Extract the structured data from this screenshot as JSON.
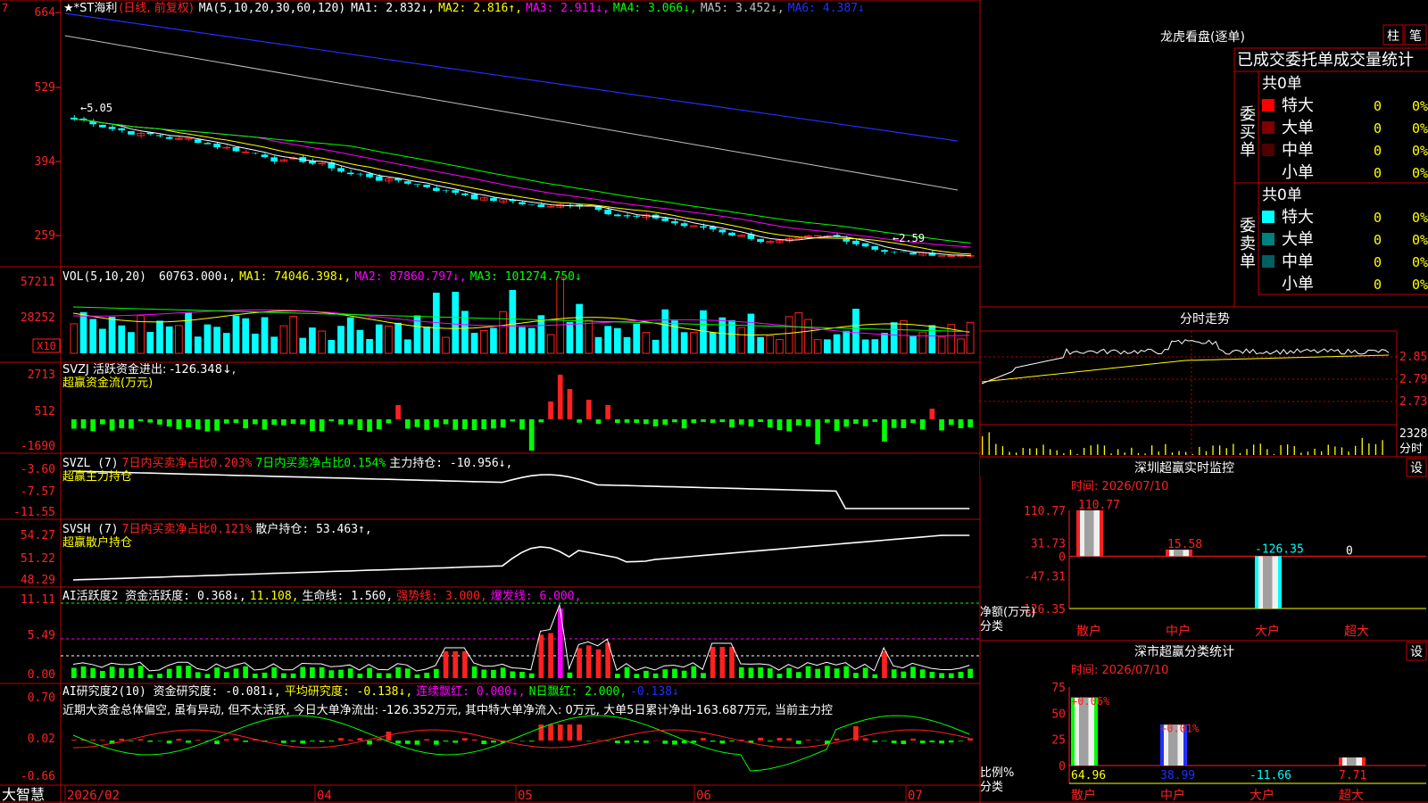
{
  "colors": {
    "up": "#ff2020",
    "down": "#00ffff",
    "frame": "#c00000",
    "yellow": "#ffff00",
    "magenta": "#ff00ff",
    "green": "#00ff00",
    "blue": "#2030ff",
    "gray": "#c0c0c0",
    "white": "#ffffff"
  },
  "header": {
    "stock": "★*ST海利",
    "period": "(日线, 前复权)",
    "ma_label": "MA(5,10,20,30,60,120)",
    "ma": [
      {
        "text": "MA1: 2.832↓,",
        "color": "#ffffff"
      },
      {
        "text": "MA2: 2.816↑,",
        "color": "#ffff00"
      },
      {
        "text": "MA3: 2.911↓,",
        "color": "#ff00ff"
      },
      {
        "text": "MA4: 3.066↓,",
        "color": "#00ff00"
      },
      {
        "text": "MA5: 3.452↓,",
        "color": "#c0c0c0"
      },
      {
        "text": "MA6: 4.387↓",
        "color": "#2030ff"
      }
    ]
  },
  "price_axis": [
    "664",
    "529",
    "394",
    "259"
  ],
  "price_labels": {
    "high": "5.05",
    "low": "2.59"
  },
  "vol_panel": {
    "label": "VOL(5,10,20)",
    "items": [
      {
        "text": "60763.000↓,",
        "color": "#ffffff"
      },
      {
        "text": "MA1: 74046.398↓,",
        "color": "#ffff00"
      },
      {
        "text": "MA2: 87860.797↓,",
        "color": "#ff00ff"
      },
      {
        "text": "MA3: 101274.750↓",
        "color": "#00ff00"
      }
    ],
    "axis": [
      "57211",
      "28252"
    ],
    "unit": "X10"
  },
  "svzj_panel": {
    "line1": "SVZJ  活跃资金进出: -126.348↓,",
    "line2": "超赢资金流(万元)",
    "axis": [
      "2713",
      "512",
      "-1690"
    ]
  },
  "svzl_panel": {
    "items": [
      {
        "text": "SVZL (7)",
        "color": "#ffffff"
      },
      {
        "text": "7日内买卖净占比0.203%",
        "color": "#ff2020"
      },
      {
        "text": "7日内买卖净占比0.154%",
        "color": "#00ff00"
      },
      {
        "text": "主力持仓: -10.956↓,",
        "color": "#ffffff"
      }
    ],
    "line2": "超赢主力持仓",
    "axis": [
      "-3.60",
      "-7.57",
      "-11.55"
    ]
  },
  "svsh_panel": {
    "items": [
      {
        "text": "SVSH (7)",
        "color": "#ffffff"
      },
      {
        "text": "7日内买卖净占比0.121%",
        "color": "#ff2020"
      },
      {
        "text": "散户持仓: 53.463↑,",
        "color": "#ffffff"
      }
    ],
    "line2": "超赢散户持仓",
    "axis": [
      "54.27",
      "51.22",
      "48.29"
    ]
  },
  "ai_active_panel": {
    "items": [
      {
        "text": "AI活跃度2 资金活跃度: 0.368↓,",
        "color": "#ffffff"
      },
      {
        "text": "11.108,",
        "color": "#ffff00"
      },
      {
        "text": "生命线: 1.560,",
        "color": "#ffffff"
      },
      {
        "text": "强势线: 3.000,",
        "color": "#ff2020"
      },
      {
        "text": "爆发线: 6.000,",
        "color": "#ff00ff"
      }
    ],
    "axis": [
      "11.11",
      "5.49",
      "0.00"
    ]
  },
  "ai_research_panel": {
    "items": [
      {
        "text": "AI研究度2(10) 资金研究度: -0.081↓,",
        "color": "#ffffff"
      },
      {
        "text": "平均研究度: -0.138↓,",
        "color": "#ffff00"
      },
      {
        "text": "连续飘红: 0.000↓,",
        "color": "#ff00ff"
      },
      {
        "text": "N日飘红: 2.000,",
        "color": "#00ff00"
      },
      {
        "text": "-0.138↓",
        "color": "#2030ff"
      }
    ],
    "comment": "近期大资金总体偏空, 虽有异动, 但不太活跃, 今日大单净流出: -126.352万元, 其中特大单净流入: 0万元, 大单5日累计净出-163.687万元, 当前主力控",
    "axis": [
      "0.70",
      "0.02",
      "-0.66"
    ]
  },
  "date_axis": {
    "corner": "大智慧",
    "labels": [
      "2026/02",
      "04",
      "05",
      "06",
      "07"
    ]
  },
  "dragon_tiger": {
    "title": "龙虎看盘(逐单)",
    "tab1": "柱",
    "tab2": "笔",
    "subtitle": "已成交委托单成交量统计",
    "buy": {
      "side": "委买单",
      "total": "共0单",
      "rows": [
        {
          "label": "特大",
          "count": "0",
          "pct": "0%",
          "color": "#ff0000"
        },
        {
          "label": "大单",
          "count": "0",
          "pct": "0%",
          "color": "#800000"
        },
        {
          "label": "中单",
          "count": "0",
          "pct": "0%",
          "color": "#500000"
        },
        {
          "label": "小单",
          "count": "0",
          "pct": "0%",
          "color": ""
        }
      ]
    },
    "sell": {
      "side": "委卖单",
      "total": "共0单",
      "rows": [
        {
          "label": "特大",
          "count": "0",
          "pct": "0%",
          "color": "#00ffff"
        },
        {
          "label": "大单",
          "count": "0",
          "pct": "0%",
          "color": "#008080"
        },
        {
          "label": "中单",
          "count": "0",
          "pct": "0%",
          "color": "#006060"
        },
        {
          "label": "小单",
          "count": "0",
          "pct": "0%",
          "color": ""
        }
      ]
    }
  },
  "intraday": {
    "title": "分时走势",
    "axis": [
      "2.850",
      "2.790",
      "2.730"
    ],
    "vol_axis": [
      "2328",
      "分时"
    ]
  },
  "sz_monitor": {
    "title": "深圳超赢实时监控",
    "settings": "设",
    "time": "时间: 2026/07/10",
    "axis": [
      "110.77",
      "31.73",
      "0",
      "-47.31",
      "-126.35"
    ],
    "unit_lines": [
      "净额(万元)",
      "分类"
    ],
    "categories": [
      "散户",
      "中户",
      "大户",
      "超大"
    ],
    "values": [
      110.77,
      15.58,
      -126.35,
      0
    ],
    "value_labels": [
      "110.77",
      "15.58",
      "-126.35",
      "0"
    ]
  },
  "sz_classify": {
    "title": "深市超赢分类统计",
    "settings": "设",
    "time": "时间: 2026/07/10",
    "axis": [
      "75",
      "50",
      "25",
      "0"
    ],
    "unit_lines": [
      "比例%",
      "分类"
    ],
    "categories": [
      "散户",
      "中户",
      "大户",
      "超大"
    ],
    "values": [
      64.96,
      38.99,
      -11.66,
      7.71
    ],
    "value_labels": [
      "64.96",
      "38.99",
      "-11.66",
      "7.71"
    ],
    "change_labels": [
      "+0.06%",
      "+0.01%",
      "",
      ""
    ]
  },
  "chart_data": [
    {
      "type": "bar",
      "title": "深圳超赢实时监控",
      "ylabel": "净额(万元)",
      "categories": [
        "散户",
        "中户",
        "大户",
        "超大"
      ],
      "values": [
        110.77,
        15.58,
        -126.35,
        0
      ],
      "ylim": [
        -126.35,
        110.77
      ]
    },
    {
      "type": "bar",
      "title": "深市超赢分类统计",
      "ylabel": "比例%",
      "categories": [
        "散户",
        "中户",
        "大户",
        "超大"
      ],
      "values": [
        64.96,
        38.99,
        -11.66,
        7.71
      ],
      "ylim": [
        0,
        75
      ]
    }
  ]
}
